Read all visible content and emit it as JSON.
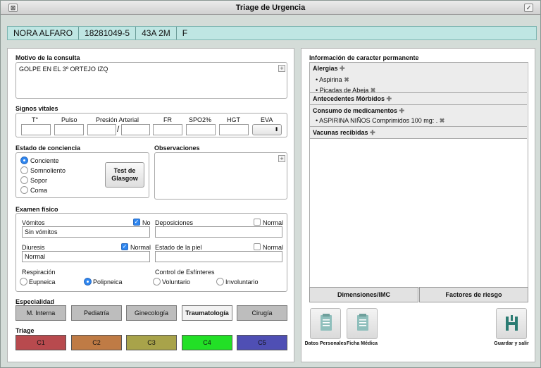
{
  "window": {
    "title": "Triage de Urgencia",
    "close_glyph": "⊠",
    "ok_glyph": "✓"
  },
  "patient": {
    "name": "NORA ALFARO",
    "id": "18281049-5",
    "age": "43A 2M",
    "sex": "F"
  },
  "motivo": {
    "title": "Motivo de la consulta",
    "value": "GOLPE EN EL 3º ORTEJO IZQ"
  },
  "signos": {
    "title": "Signos vitales",
    "labels": [
      "T°",
      "Pulso",
      "Presión Arterial",
      "FR",
      "SPO2%",
      "HGT",
      "EVA"
    ],
    "pa_sep": "/"
  },
  "conciencia": {
    "title": "Estado de conciencia",
    "options": [
      "Conciente",
      "Somnoliento",
      "Sopor",
      "Coma"
    ],
    "selected": 0,
    "glasgow_button": "Test de Glasgow"
  },
  "observaciones": {
    "title": "Observaciones",
    "value": ""
  },
  "examen": {
    "title": "Examen físico",
    "vomitos": {
      "label": "Vómitos",
      "check_label": "No",
      "checked": true,
      "value": "Sin vómitos"
    },
    "deposiciones": {
      "label": "Deposiciones",
      "check_label": "Normal",
      "checked": false,
      "value": ""
    },
    "diuresis": {
      "label": "Diuresis",
      "check_label": "Normal",
      "checked": true,
      "value": "Normal"
    },
    "piel": {
      "label": "Estado de la piel",
      "check_label": "Normal",
      "checked": false,
      "value": ""
    },
    "respiracion": {
      "label": "Respiración",
      "options": [
        "Eupneica",
        "Polipneica"
      ],
      "selected": 1
    },
    "esfinteres": {
      "label": "Control de Esfínteres",
      "options": [
        "Voluntario",
        "Involuntario"
      ],
      "selected": -1
    }
  },
  "especialidad": {
    "title": "Especialidad",
    "items": [
      "M. Interna",
      "Pediatría",
      "Ginecología",
      "Traumatología",
      "Cirugía"
    ],
    "selected": 3
  },
  "triage": {
    "title": "Triage",
    "items": [
      {
        "label": "C1",
        "color": "#b84a4e"
      },
      {
        "label": "C2",
        "color": "#bf7b45"
      },
      {
        "label": "C3",
        "color": "#a8a34a"
      },
      {
        "label": "C4",
        "color": "#22e026"
      },
      {
        "label": "C5",
        "color": "#4f4fb4"
      }
    ]
  },
  "permanente": {
    "title": "Información de caracter permanente",
    "alergias": {
      "title": "Alergias",
      "items": [
        "• Aspirina",
        "• Picadas de Abeja"
      ]
    },
    "antecedentes": {
      "title": "Antecedentes Mórbidos"
    },
    "medicamentos": {
      "title": "Consumo de medicamentos",
      "items": [
        "• ASPIRINA NIÑOS Comprimidos 100 mg: ."
      ]
    },
    "vacunas": {
      "title": "Vacunas recibidas"
    }
  },
  "tabs": {
    "dimensiones": "Dimensiones/IMC",
    "factores": "Factores de riesgo"
  },
  "actions": {
    "datos": "Datos Personales",
    "ficha": "Ficha Médica",
    "guardar": "Guardar y salir"
  },
  "colors": {
    "accent": "#2e86f0",
    "patient_bar": "#bfe6e3"
  }
}
